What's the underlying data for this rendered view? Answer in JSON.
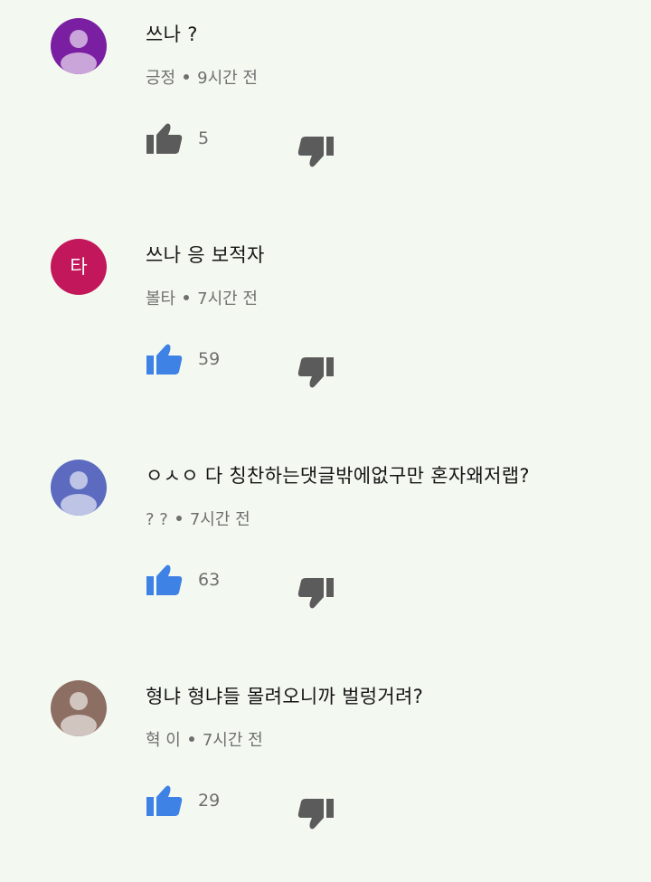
{
  "comments": [
    {
      "avatar_color": "#7b1fa2",
      "avatar_type": "person-silhouette",
      "avatar_initial": "",
      "text": "쓰나 ?",
      "author": "긍정",
      "time": "9시간 전",
      "likes": "5",
      "like_color": "#5b5b5b"
    },
    {
      "avatar_color": "#c2185b",
      "avatar_type": "initial",
      "avatar_initial": "타",
      "text": "쓰나 응 보적자",
      "author": "볼타",
      "time": "7시간 전",
      "likes": "59",
      "like_color": "#3f82e6"
    },
    {
      "avatar_color": "#5c6bc0",
      "avatar_type": "person-silhouette",
      "avatar_initial": "",
      "text": "ㅇㅅㅇ 다 칭찬하는댓글밖에없구만 혼자왜저랩?",
      "author": "? ?",
      "time": "7시간 전",
      "likes": "63",
      "like_color": "#3f82e6"
    },
    {
      "avatar_color": "#8d6e63",
      "avatar_type": "person-silhouette",
      "avatar_initial": "",
      "text": "형냐 형냐들 몰려오니까 벌렁거려?",
      "author": "혁 이",
      "time": "7시간 전",
      "likes": "29",
      "like_color": "#3f82e6"
    }
  ],
  "icons": {
    "like": "thumbs-up-icon",
    "dislike": "thumbs-down-icon"
  },
  "dislike_color": "#5b5b5b"
}
